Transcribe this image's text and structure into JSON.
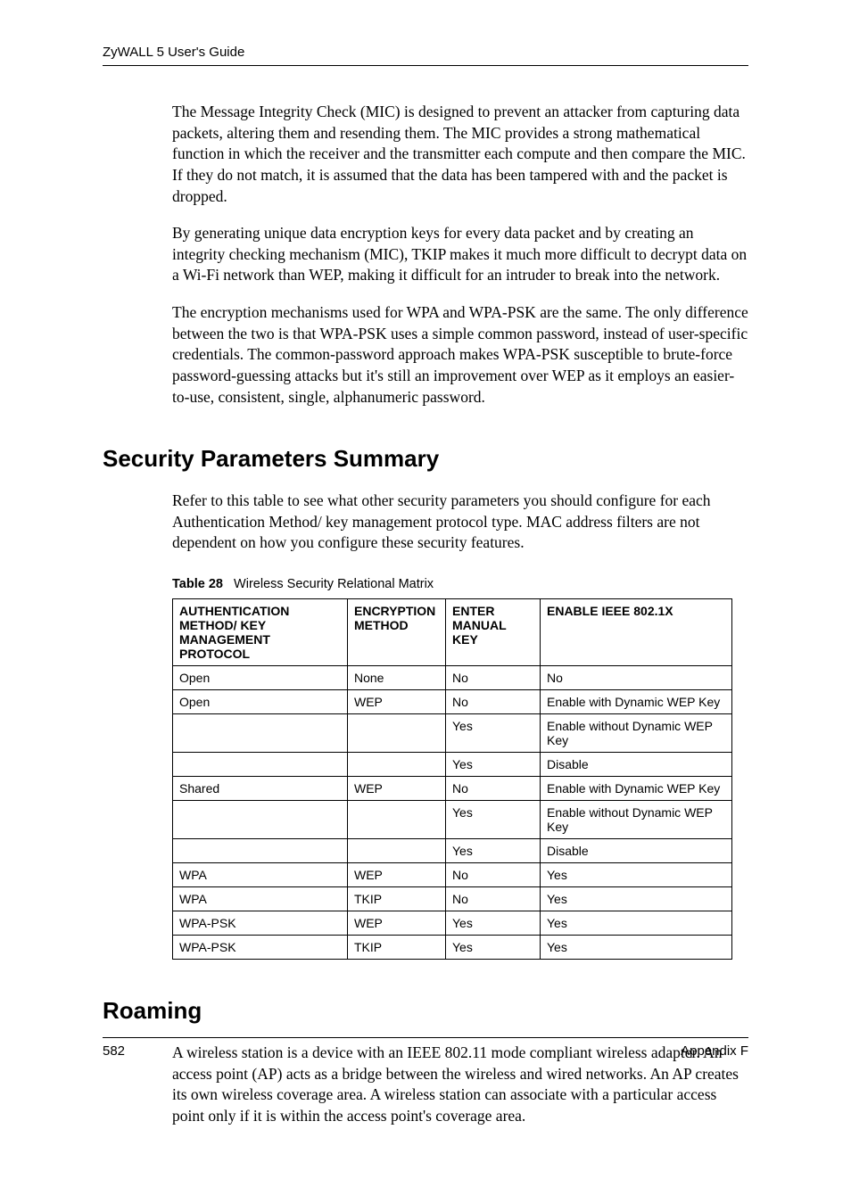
{
  "header": {
    "title": "ZyWALL 5 User's Guide"
  },
  "paragraphs": {
    "p1": "The Message Integrity Check (MIC) is designed to prevent an attacker from capturing data packets, altering them and resending them. The MIC provides a strong mathematical function in which the receiver and the transmitter each compute and then compare the MIC. If they do not match, it is assumed that the data has been tampered with and the packet is dropped.",
    "p2": "By generating unique data encryption keys for every data packet and by creating an integrity checking mechanism (MIC), TKIP makes it much more difficult to decrypt data on a Wi-Fi network than WEP, making it difficult for an intruder to break into the network.",
    "p3": "The encryption mechanisms used for WPA and WPA-PSK are the same. The only difference between the two is that WPA-PSK uses a simple common password, instead of user-specific credentials. The common-password approach makes WPA-PSK susceptible to brute-force password-guessing attacks but it's still an improvement over WEP as it employs an easier-to-use, consistent, single, alphanumeric password.",
    "security_intro": "Refer to this table to see what other security parameters you should configure for each Authentication Method/ key management protocol type. MAC address filters are not dependent on how you configure these security features.",
    "roaming_intro": "A wireless station is a device with an IEEE 802.11 mode compliant wireless adapter. An access point (AP) acts as a bridge between the wireless and wired networks. An AP creates its own wireless coverage area. A wireless station can associate with a particular access point only if it is within the access point's coverage area."
  },
  "headings": {
    "security": "Security Parameters Summary",
    "roaming": "Roaming"
  },
  "table": {
    "caption_label": "Table 28",
    "caption_text": "Wireless Security Relational Matrix",
    "headers": {
      "auth": "AUTHENTICATION METHOD/ KEY MANAGEMENT PROTOCOL",
      "enc": "ENCRYPTION METHOD",
      "manual": "ENTER MANUAL KEY",
      "ieee": "ENABLE IEEE 802.1X"
    },
    "rows": [
      {
        "auth": "Open",
        "enc": "None",
        "manual": "No",
        "ieee": "No"
      },
      {
        "auth": "Open",
        "enc": "WEP",
        "manual": "No",
        "ieee": "Enable with Dynamic WEP Key"
      },
      {
        "auth": "",
        "enc": "",
        "manual": "Yes",
        "ieee": "Enable without Dynamic WEP Key"
      },
      {
        "auth": "",
        "enc": "",
        "manual": "Yes",
        "ieee": "Disable"
      },
      {
        "auth": "Shared",
        "enc": "WEP",
        "manual": "No",
        "ieee": "Enable with Dynamic WEP Key"
      },
      {
        "auth": "",
        "enc": "",
        "manual": "Yes",
        "ieee": "Enable without Dynamic WEP Key"
      },
      {
        "auth": "",
        "enc": "",
        "manual": "Yes",
        "ieee": "Disable"
      },
      {
        "auth": "WPA",
        "enc": "WEP",
        "manual": "No",
        "ieee": "Yes"
      },
      {
        "auth": "WPA",
        "enc": "TKIP",
        "manual": "No",
        "ieee": "Yes"
      },
      {
        "auth": "WPA-PSK",
        "enc": "WEP",
        "manual": "Yes",
        "ieee": "Yes"
      },
      {
        "auth": "WPA-PSK",
        "enc": "TKIP",
        "manual": "Yes",
        "ieee": "Yes"
      }
    ]
  },
  "footer": {
    "page": "582",
    "section": "Appendix F"
  }
}
